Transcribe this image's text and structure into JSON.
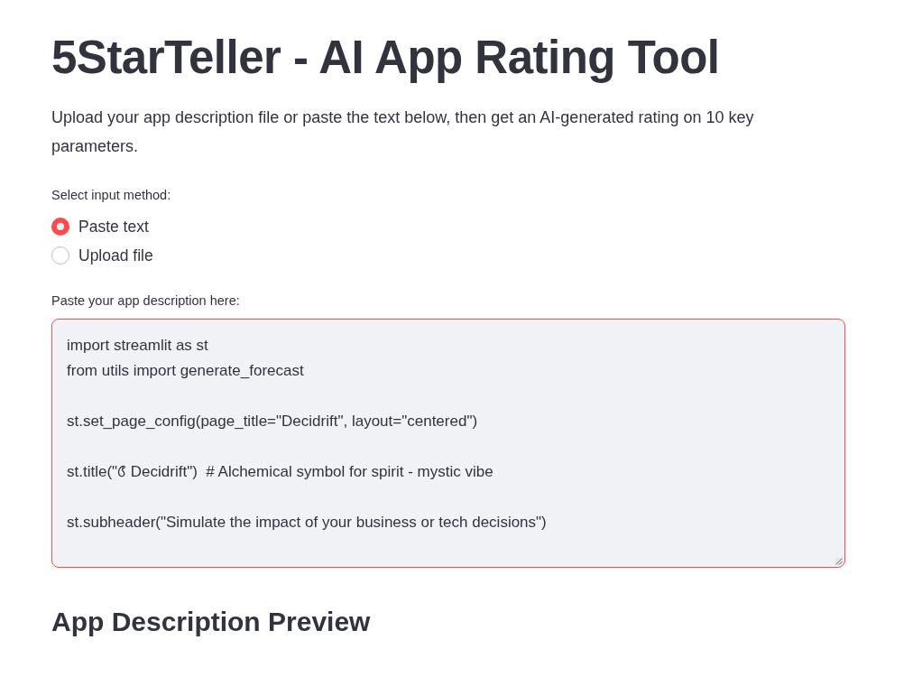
{
  "title": "5StarTeller - AI App Rating Tool",
  "intro": "Upload your app description file or paste the text below, then get an AI-generated rating on 10 key parameters.",
  "input_method": {
    "label": "Select input method:",
    "options": [
      {
        "label": "Paste text",
        "selected": true
      },
      {
        "label": "Upload file",
        "selected": false
      }
    ]
  },
  "description_field": {
    "label": "Paste your app description here:",
    "focused": true,
    "value": "import streamlit as st\nfrom utils import generate_forecast\n\nst.set_page_config(page_title=\"Decidrift\", layout=\"centered\")\n\nst.title(\"🝭 Decidrift\")  # Alchemical symbol for spirit - mystic vibe\n\nst.subheader(\"Simulate the impact of your business or tech decisions\")"
  },
  "preview_heading": "App Description Preview"
}
